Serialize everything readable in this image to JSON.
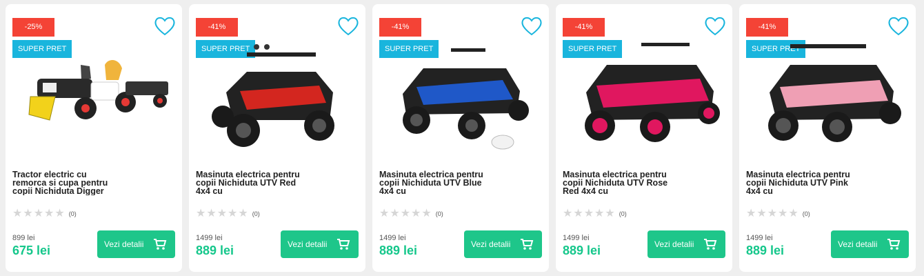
{
  "products": [
    {
      "discount": "-25%",
      "badge": "SUPER PRET",
      "title": "Tractor electric cu remorca si cupa pentru copii Nichiduta Digger",
      "rating_count": "(0)",
      "old_price": "899 lei",
      "price": "675 lei",
      "button_label": "Vezi detalii",
      "icon_heart": "heart-outline-icon",
      "icon_cart": "cart-icon",
      "image": "yellow-tractor-with-trailer",
      "color": "#e6b53a"
    },
    {
      "discount": "-41%",
      "badge": "SUPER PRET",
      "title": "Masinuta electrica pentru copii Nichiduta UTV Red 4x4 cu",
      "rating_count": "(0)",
      "old_price": "1499 lei",
      "price": "889 lei",
      "button_label": "Vezi detalii",
      "icon_heart": "heart-outline-icon",
      "icon_cart": "cart-icon",
      "image": "red-utv-buggy",
      "color": "#d3261f"
    },
    {
      "discount": "-41%",
      "badge": "SUPER PRET",
      "title": "Masinuta electrica pentru copii Nichiduta UTV Blue 4x4 cu",
      "rating_count": "(0)",
      "old_price": "1499 lei",
      "price": "889 lei",
      "button_label": "Vezi detalii",
      "icon_heart": "heart-outline-icon",
      "icon_cart": "cart-icon",
      "image": "blue-utv-buggy",
      "color": "#1f58c8"
    },
    {
      "discount": "-41%",
      "badge": "SUPER PRET",
      "title": "Masinuta electrica pentru copii Nichiduta UTV Rose Red 4x4 cu",
      "rating_count": "(0)",
      "old_price": "1499 lei",
      "price": "889 lei",
      "button_label": "Vezi detalii",
      "icon_heart": "heart-outline-icon",
      "icon_cart": "cart-icon",
      "image": "rose-red-utv-buggy",
      "color": "#e0175f"
    },
    {
      "discount": "-41%",
      "badge": "SUPER PRET",
      "title": "Masinuta electrica pentru copii Nichiduta UTV Pink 4x4 cu",
      "rating_count": "(0)",
      "old_price": "1499 lei",
      "price": "889 lei",
      "button_label": "Vezi detalii",
      "icon_heart": "heart-outline-icon",
      "icon_cart": "cart-icon",
      "image": "pink-utv-buggy",
      "color": "#ef9fb4"
    }
  ],
  "colors": {
    "discount_badge": "#f44336",
    "super_badge": "#19b5dd",
    "button": "#1ec68a",
    "price": "#15c78b",
    "heart": "#19b5dd"
  }
}
